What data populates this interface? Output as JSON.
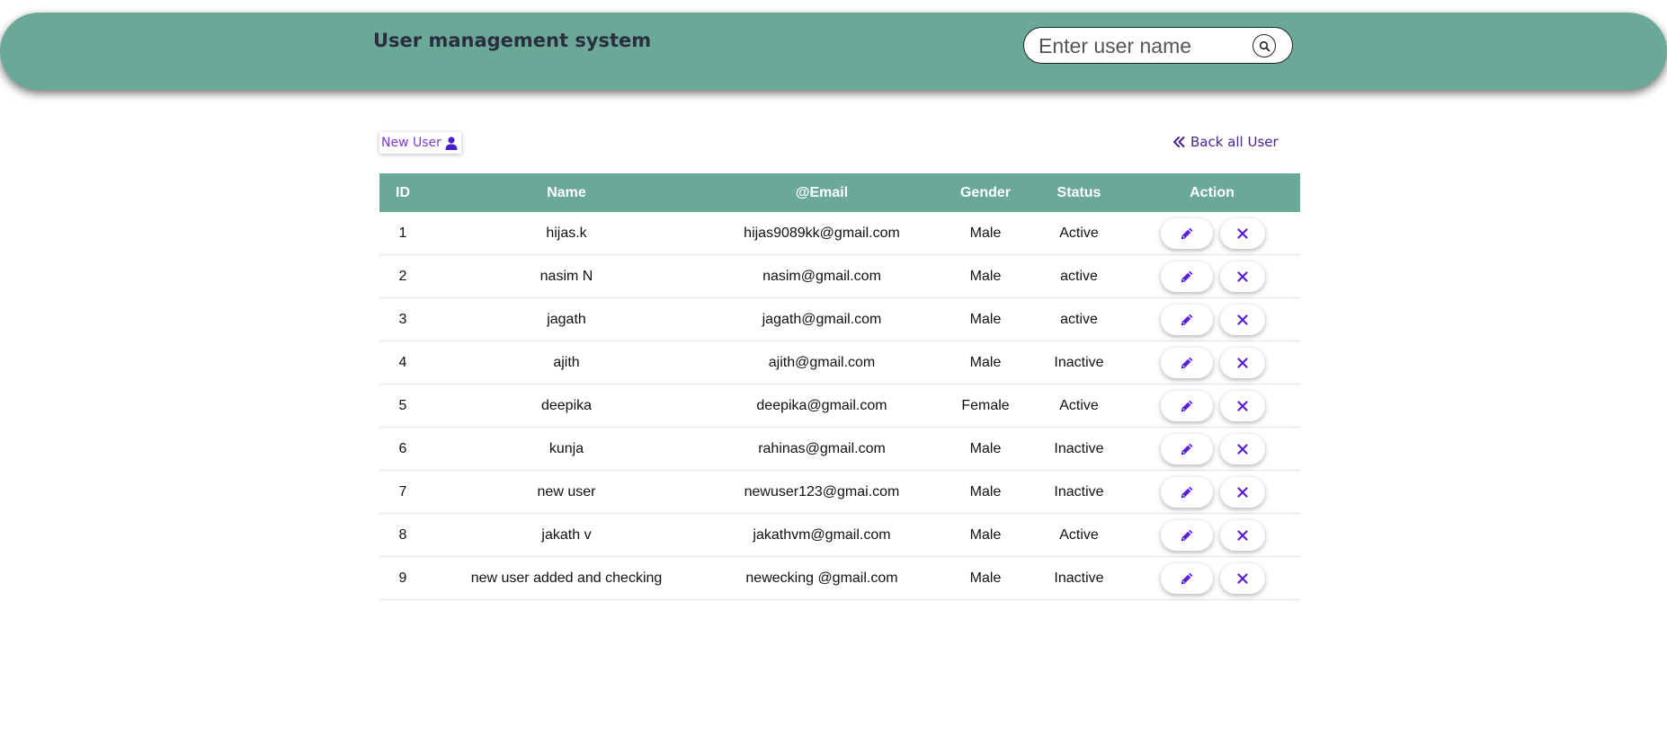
{
  "header": {
    "title": "User management system",
    "search": {
      "placeholder": "Enter user name",
      "value": "",
      "button_icon": "search-icon"
    }
  },
  "toolbar": {
    "new_user_label": "New User",
    "new_user_icon": "user-icon",
    "back_label": "Back all User",
    "back_icon": "double-chevron-left-icon"
  },
  "table": {
    "columns": [
      "ID",
      "Name",
      "@Email",
      "Gender",
      "Status",
      "Action"
    ],
    "rows": [
      {
        "id": "1",
        "name": "hijas.k",
        "email": "hijas9089kk@gmail.com",
        "gender": "Male",
        "status": "Active"
      },
      {
        "id": "2",
        "name": "nasim N",
        "email": "nasim@gmail.com",
        "gender": "Male",
        "status": "active"
      },
      {
        "id": "3",
        "name": "jagath",
        "email": "jagath@gmail.com",
        "gender": "Male",
        "status": "active"
      },
      {
        "id": "4",
        "name": "ajith",
        "email": "ajith@gmail.com",
        "gender": "Male",
        "status": "Inactive"
      },
      {
        "id": "5",
        "name": "deepika",
        "email": "deepika@gmail.com",
        "gender": "Female",
        "status": "Active"
      },
      {
        "id": "6",
        "name": "kunja",
        "email": "rahinas@gmail.com",
        "gender": "Male",
        "status": "Inactive"
      },
      {
        "id": "7",
        "name": "new user",
        "email": "newuser123@gmai.com",
        "gender": "Male",
        "status": "Inactive"
      },
      {
        "id": "8",
        "name": "jakath v",
        "email": "jakathvm@gmail.com",
        "gender": "Male",
        "status": "Active"
      },
      {
        "id": "9",
        "name": "new user added and checking",
        "email": "newecking @gmail.com",
        "gender": "Male",
        "status": "Inactive"
      }
    ],
    "row_actions": {
      "edit_icon": "pencil-icon",
      "delete_icon": "close-icon"
    }
  },
  "colors": {
    "header_bg": "#6aa898",
    "accent_purple": "#5b1fd6",
    "title_text": "#2a2e3e"
  }
}
